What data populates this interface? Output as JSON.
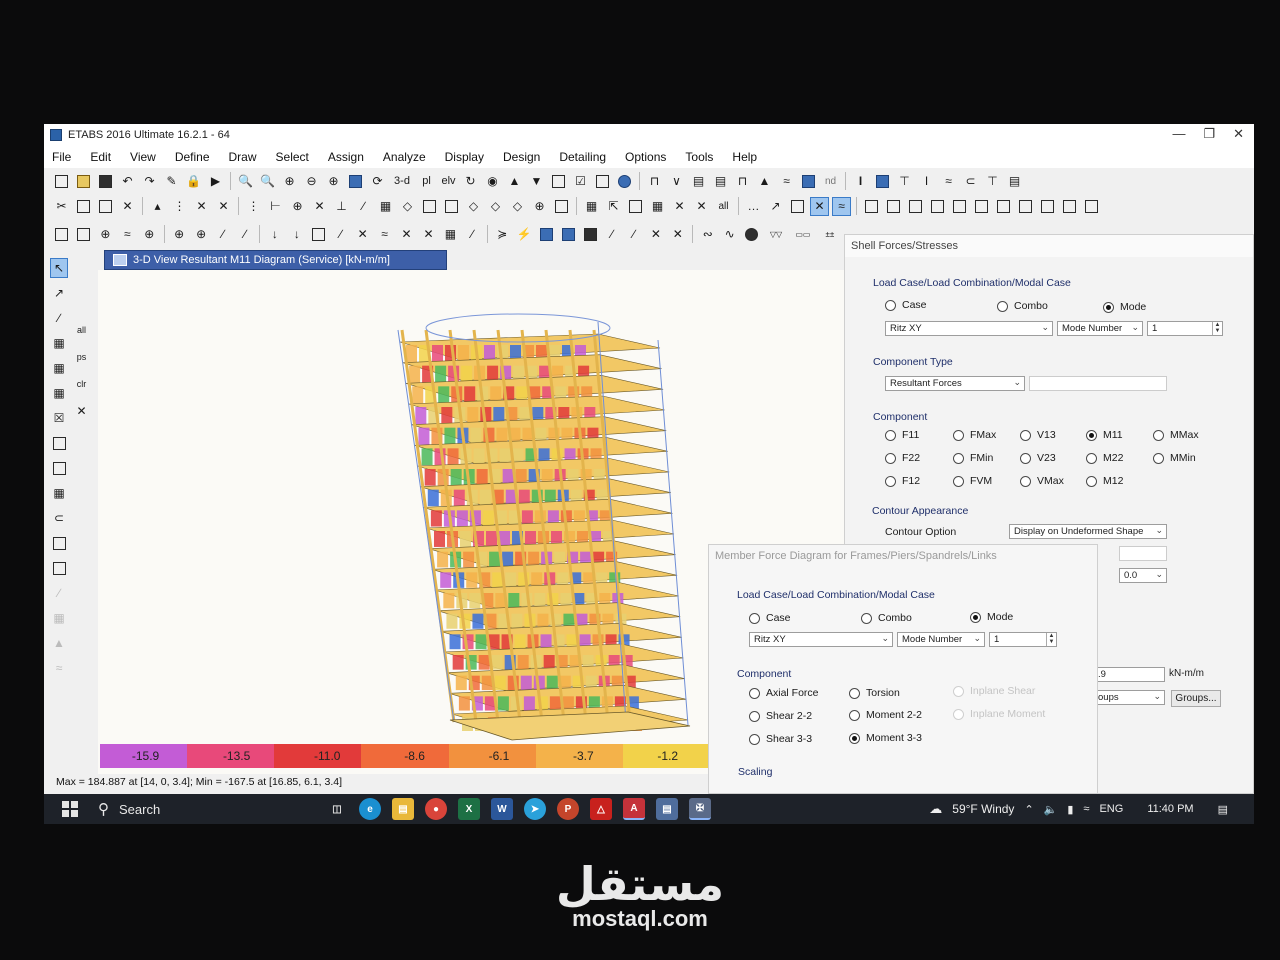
{
  "window": {
    "title": "ETABS 2016 Ultimate 16.2.1 - 64"
  },
  "menu": [
    "File",
    "Edit",
    "View",
    "Define",
    "Draw",
    "Select",
    "Assign",
    "Analyze",
    "Display",
    "Design",
    "Detailing",
    "Options",
    "Tools",
    "Help"
  ],
  "toolbar": {
    "view3d_label": "3-d",
    "plan_label": "pl",
    "elev_label": "elv",
    "nd_label": "nd",
    "all_label": "all"
  },
  "view_tab": {
    "title": "3-D View   Resultant M11 Diagram   (Service)  [kN-m/m]"
  },
  "legend": {
    "colors": [
      "#c35cd6",
      "#e8497a",
      "#e23a3a",
      "#f06a3a",
      "#f2913e",
      "#f4b24a",
      "#f2d24a"
    ],
    "labels": [
      "-15.9",
      "-13.5",
      "-11.0",
      "-8.6",
      "-6.1",
      "-3.7",
      "-1.2"
    ]
  },
  "status": {
    "text": "Max = 184.887 at [14, 0, 3.4];  Min = -167.5 at [16.85, 6.1, 3.4]"
  },
  "shell_dialog": {
    "title": "Shell Forces/Stresses",
    "load_group": "Load Case/Load Combination/Modal Case",
    "case_label": "Case",
    "combo_label": "Combo",
    "mode_label": "Mode",
    "selected_case": "Ritz XY",
    "mode_number_label": "Mode Number",
    "mode_value": "1",
    "component_type_group": "Component Type",
    "component_type_value": "Resultant Forces",
    "component_group": "Component",
    "components": [
      "F11",
      "FMax",
      "V13",
      "M11",
      "MMax",
      "F22",
      "FMin",
      "V23",
      "M22",
      "MMin",
      "F12",
      "FVM",
      "VMax",
      "M12"
    ],
    "selected_component": "M11",
    "contour_group": "Contour Appearance",
    "contour_option_label": "Contour Option",
    "contour_option_value": "Display on Undeformed Shape",
    "offset_value": "0.0",
    "range_value": ".9",
    "unit": "kN-m/m",
    "groups_combo": "oups",
    "groups_button": "Groups..."
  },
  "member_dialog": {
    "title": "Member Force Diagram for Frames/Piers/Spandrels/Links",
    "load_group": "Load Case/Load Combination/Modal Case",
    "case_label": "Case",
    "combo_label": "Combo",
    "mode_label": "Mode",
    "selected_case": "Ritz XY",
    "mode_number_label": "Mode Number",
    "mode_value": "1",
    "component_group": "Component",
    "axial": "Axial Force",
    "torsion": "Torsion",
    "inplane_shear": "Inplane Shear",
    "shear22": "Shear 2-2",
    "moment22": "Moment 2-2",
    "inplane_moment": "Inplane Moment",
    "shear33": "Shear 3-3",
    "moment33": "Moment 3-3",
    "scaling_group": "Scaling"
  },
  "taskbar": {
    "search_label": "Search",
    "weather": "59°F  Windy",
    "language": "ENG",
    "time": "11:40 PM"
  },
  "watermark": {
    "arabic": "مستقل",
    "latin": "mostaql.com"
  }
}
